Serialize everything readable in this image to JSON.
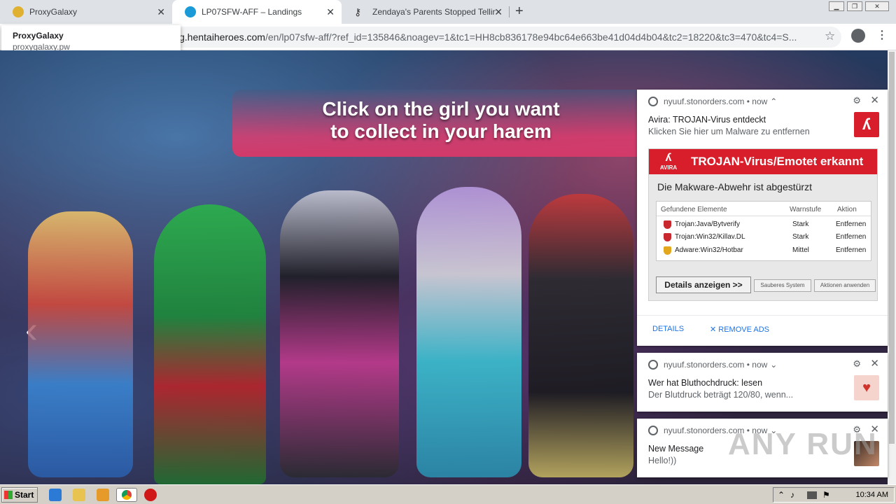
{
  "tabs": [
    {
      "label": "ProxyGalaxy",
      "favicon_color": "#e0b030"
    },
    {
      "label": "LP07SFW-AFF – Landings",
      "favicon_color": "#1a9ad6"
    },
    {
      "label": "Zendaya's Parents Stopped Telling H",
      "favicon_color": "#333333"
    }
  ],
  "window_controls": {
    "minimize": "▁",
    "maximize": "❐",
    "close": "✕"
  },
  "omnibox": {
    "prefix": "g.hentaiheroes.com",
    "path": "/en/lp07sfw-aff/?ref_id=135846&noagev=1&tc1=HH8cb836178e94bc64e663be41d04d4b04&tc2=18220&tc3=470&tc4=S..."
  },
  "hovercard": {
    "title": "ProxyGalaxy",
    "url": "proxygalaxy.pw"
  },
  "page": {
    "headline_line1": "Click on the girl you want",
    "headline_line2": "to collect in your harem",
    "prev_arrow": "‹"
  },
  "notifications": [
    {
      "source": "nyuuf.stonorders.com",
      "time": "• now",
      "title": "Avira: TROJAN-Virus entdeckt",
      "body": "Klicken Sie hier um Malware zu entfernen",
      "image": {
        "header": "TROJAN-Virus/Emotet erkannt",
        "logo": "AVIRA",
        "subtitle": "Die Makware-Abwehr ist abgestürzt",
        "columns": [
          "Gefundene Elemente",
          "Warnstufe",
          "Aktion"
        ],
        "rows": [
          {
            "name": "Trojan:Java/Bytverify",
            "level": "Stark",
            "action": "Entfernen"
          },
          {
            "name": "Trojan:Win32/Killav.DL",
            "level": "Stark",
            "action": "Entfernen"
          },
          {
            "name": "Adware:Win32/Hotbar",
            "level": "Mittel",
            "action": "Entfernen"
          }
        ],
        "btn_details": "Details anzeigen >>",
        "btn_clean": "Sauberes System",
        "btn_apply": "Aktionen anwenden"
      },
      "action_details": "DETAILS",
      "action_remove": "✕ REMOVE ADS"
    },
    {
      "source": "nyuuf.stonorders.com",
      "time": "• now",
      "title": "Wer hat Bluthochdruck: lesen",
      "body": "Der Blutdruck beträgt 120/80, wenn..."
    },
    {
      "source": "nyuuf.stonorders.com",
      "time": "• now",
      "title": "New Message",
      "body": "Hello!))"
    }
  ],
  "watermark": "ANY RUN",
  "taskbar": {
    "start": "Start",
    "clock": "10:34 AM"
  }
}
